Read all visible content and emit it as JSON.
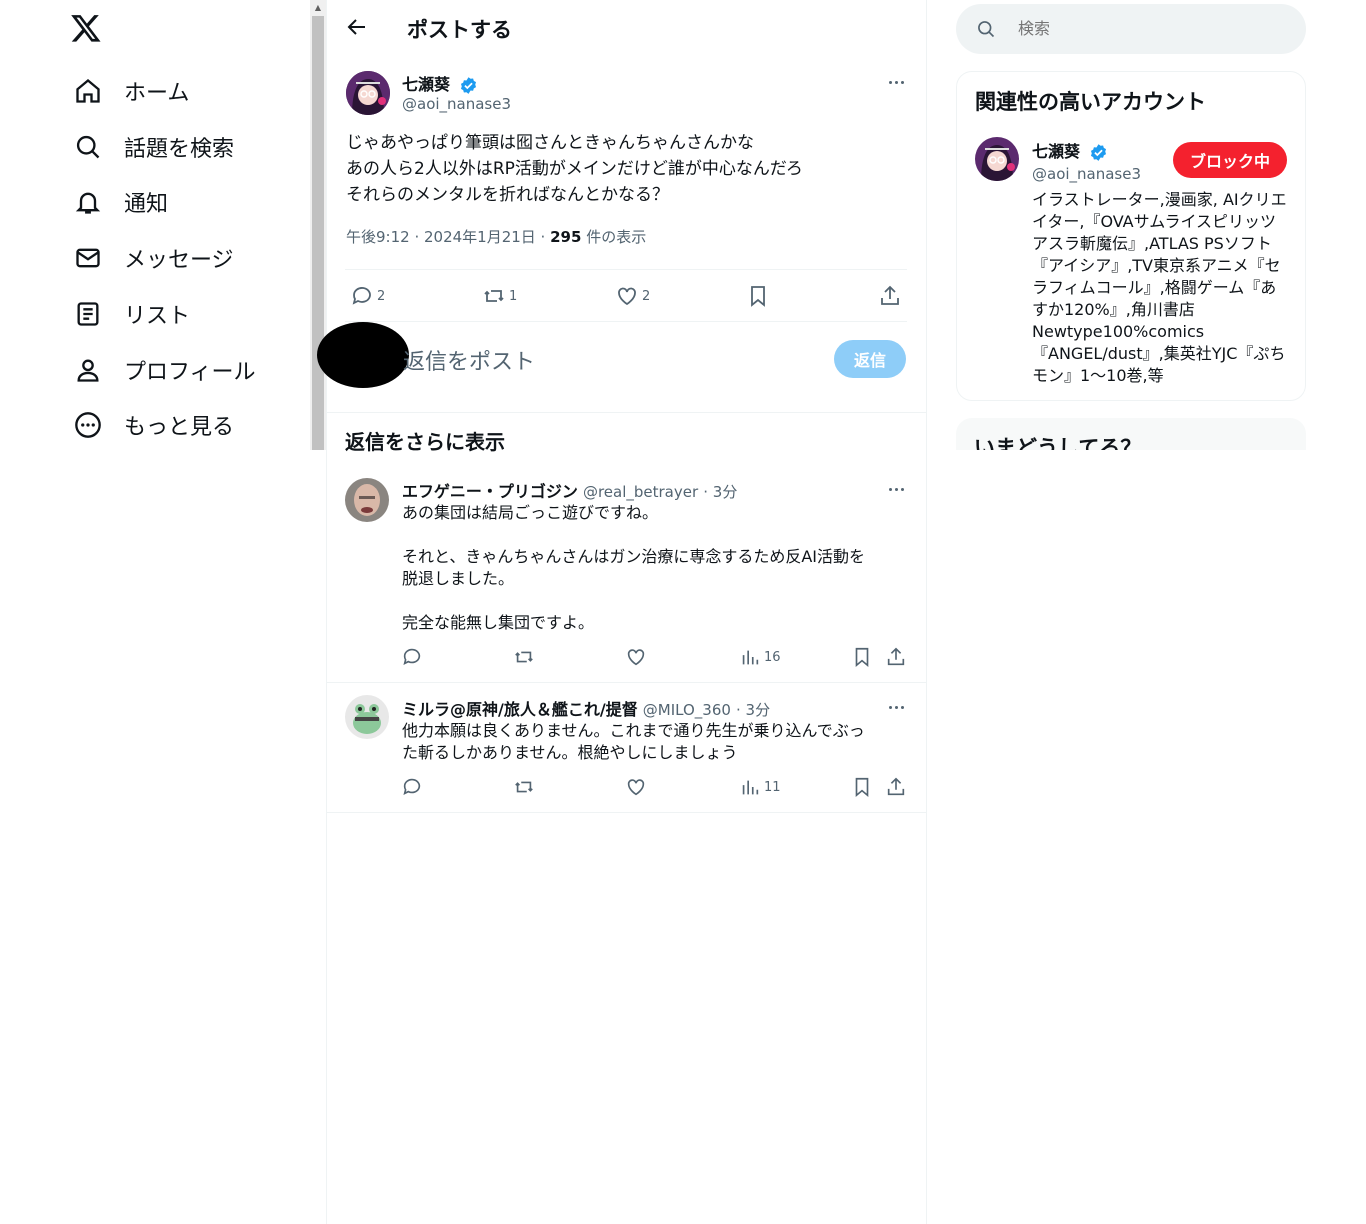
{
  "nav": {
    "items": [
      {
        "label": "ホーム",
        "icon": "home-icon"
      },
      {
        "label": "話題を検索",
        "icon": "search-icon"
      },
      {
        "label": "通知",
        "icon": "bell-icon"
      },
      {
        "label": "メッセージ",
        "icon": "mail-icon"
      },
      {
        "label": "リスト",
        "icon": "list-icon"
      },
      {
        "label": "プロフィール",
        "icon": "person-icon"
      },
      {
        "label": "もっと見る",
        "icon": "more-circle-icon"
      }
    ]
  },
  "header": {
    "title": "ポストする"
  },
  "post": {
    "author_name": "七瀬葵",
    "author_handle": "@aoi_nanase3",
    "text": "じゃあやっぱり筆頭は囮さんときゃんちゃんさんかな\nあの人ら2人以外はRP活動がメインだけど誰が中心なんだろ\nそれらのメンタルを折ればなんとかなる？",
    "meta_time": "午後9:12 · 2024年1月21日 · ",
    "meta_views": "295",
    "meta_views_suffix": " 件の表示",
    "replies": "2",
    "reposts": "1",
    "likes": "2"
  },
  "reply_box": {
    "placeholder": "返信をポスト",
    "button": "返信"
  },
  "more_replies_title": "返信をさらに表示",
  "replies": [
    {
      "name": "エフゲニー・プリゴジン",
      "handle": "@real_betrayer",
      "time": "· 3分",
      "text": "あの集団は結局ごっこ遊びですね。\n\nそれと、きゃんちゃんさんはガン治療に専念するため反AI活動を\n脱退しました。\n\n完全な能無し集団ですよ。",
      "views": "16"
    },
    {
      "name": "ミルラ@原神/旅人＆艦これ/提督",
      "handle": "@MILO_360",
      "time": "· 3分",
      "text": "他力本願は良くありません。これまで通り先生が乗り込んでぶっ\nた斬るしかありません。根絶やしにしましょう",
      "views": "11"
    }
  ],
  "search": {
    "placeholder": "検索"
  },
  "related": {
    "title": "関連性の高いアカウント",
    "name": "七瀬葵",
    "handle": "@aoi_nanase3",
    "button": "ブロック中",
    "bio": "イラストレーター,漫画家, AIクリエイター,『OVAサムライスピリッツアスラ斬魔伝』,ATLAS PSソフト『アイシア』,TV東京系アニメ『セラフィムコール』,格闘ゲーム『あすか120%』,角川書店Newtype100%comics『ANGEL/dust』,集英社YJC『ぷちモン』1〜10巻,等"
  },
  "whats_happening": {
    "title": "いまどうしてる？"
  },
  "colors": {
    "accent": "#1d9bf0",
    "block": "#f4212e",
    "reply_disabled": "#8ecdf8"
  }
}
